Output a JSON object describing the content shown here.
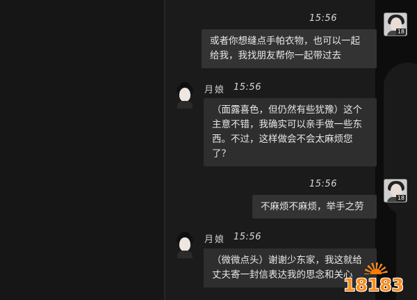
{
  "messages": [
    {
      "sender": "player",
      "time": "15:56",
      "text": "或者你想缝点手帕衣物，也可以一起给我，我找朋友帮你一起带过去",
      "age_badge": "18"
    },
    {
      "sender": "npc",
      "name": "月娘",
      "time": "15:56",
      "text": "（面露喜色，但仍然有些犹豫）这个主意不错，我确实可以亲手做一些东西。不过，这样做会不会太麻烦您了？"
    },
    {
      "sender": "player",
      "time": "15:56",
      "text": "不麻烦不麻烦，举手之劳",
      "age_badge": "18"
    },
    {
      "sender": "npc",
      "name": "月娘",
      "time": "15:56",
      "text": "（微微点头）谢谢少东家，我这就给丈夫寄一封信表达我的思念和关心"
    }
  ],
  "watermark": {
    "text": "18183"
  },
  "colors": {
    "background": "#141414",
    "bubble": "#2e2e2e",
    "watermark": "#ff8c1a"
  }
}
